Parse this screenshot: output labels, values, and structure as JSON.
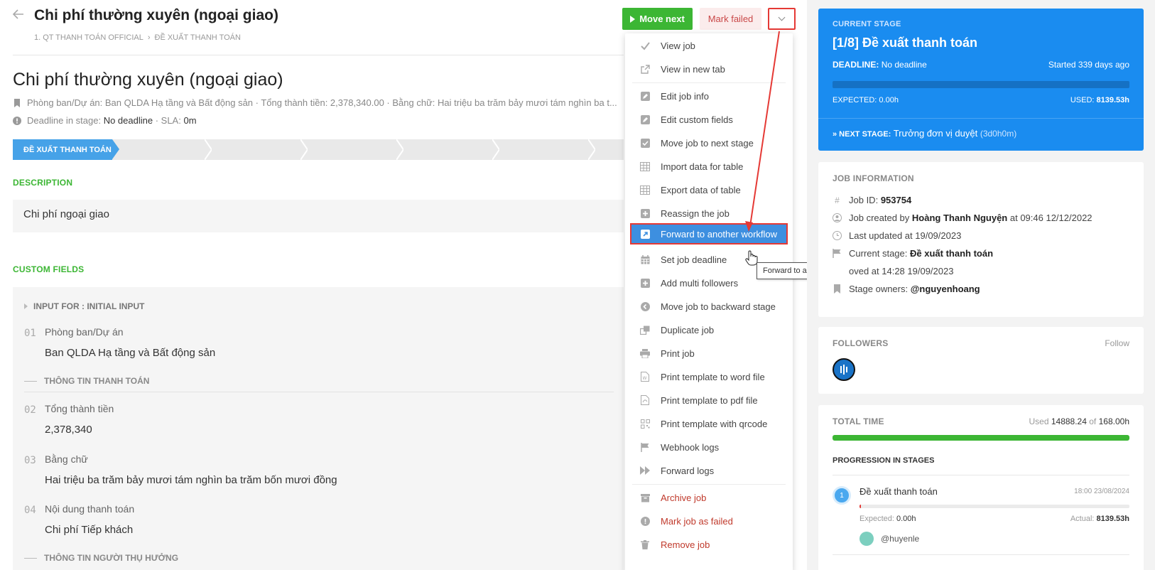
{
  "header": {
    "title": "Chi phí thường xuyên (ngoại giao)",
    "breadcrumb": [
      "1. QT THANH TOÁN OFFICIAL",
      "ĐỀ XUẤT THANH TOÁN"
    ],
    "buttons": {
      "move_next": "Move next",
      "mark_failed": "Mark failed"
    }
  },
  "job": {
    "title": "Chi phí thường xuyên (ngoại giao)",
    "summary": "Phòng ban/Dự án: Ban QLDA Hạ tầng và Bất động sản · Tổng thành tiền: 2,378,340.00 · Bằng chữ: Hai triệu ba trăm bảy mươi tám nghìn ba t...",
    "deadline_label": "Deadline in stage:",
    "deadline_value": "No deadline",
    "sla_label": "· SLA:",
    "sla_value": "0m",
    "active_stage": "ĐỀ XUẤT THANH TOÁN"
  },
  "description": {
    "label": "DESCRIPTION",
    "text": "Chi phí ngoại giao"
  },
  "custom_fields": {
    "label": "CUSTOM FIELDS",
    "group": "INPUT FOR : INITIAL INPUT",
    "fields": [
      {
        "num": "01",
        "label": "Phòng ban/Dự án",
        "value": "Ban QLDA Hạ tầng và Bất động sản"
      },
      {
        "num": "02",
        "label": "Tổng thành tiền",
        "value": "2,378,340"
      },
      {
        "num": "03",
        "label": "Bằng chữ",
        "value": "Hai triệu ba trăm bảy mươi tám nghìn ba trăm bốn mươi đồng"
      },
      {
        "num": "04",
        "label": "Nội dung thanh toán",
        "value": "Chi phí Tiếp khách"
      }
    ],
    "sections": [
      "THÔNG TIN THANH TOÁN",
      "THÔNG TIN NGƯỜI THỤ HƯỞNG"
    ]
  },
  "menu": {
    "items": [
      {
        "label": "View job",
        "icon": "check-icon"
      },
      {
        "label": "View in new tab",
        "icon": "external-link-icon"
      },
      {
        "label": "Edit job info",
        "icon": "edit-icon"
      },
      {
        "label": "Edit custom fields",
        "icon": "edit-icon"
      },
      {
        "label": "Move job to next stage",
        "icon": "check-square-icon"
      },
      {
        "label": "Import data for table",
        "icon": "table-icon"
      },
      {
        "label": "Export data of table",
        "icon": "table-icon"
      },
      {
        "label": "Reassign the job",
        "icon": "plus-square-icon"
      },
      {
        "label": "Forward to another workflow",
        "icon": "share-square-icon"
      },
      {
        "label": "Set job deadline",
        "icon": "calendar-icon"
      },
      {
        "label": "Add multi followers",
        "icon": "plus-square-icon"
      },
      {
        "label": "Move job to backward stage",
        "icon": "arrow-circle-left-icon"
      },
      {
        "label": "Duplicate job",
        "icon": "copy-icon"
      },
      {
        "label": "Print job",
        "icon": "printer-icon"
      },
      {
        "label": "Print template to word file",
        "icon": "word-file-icon"
      },
      {
        "label": "Print template to pdf file",
        "icon": "pdf-file-icon"
      },
      {
        "label": "Print template with qrcode",
        "icon": "qrcode-icon"
      },
      {
        "label": "Webhook logs",
        "icon": "flag-icon"
      },
      {
        "label": "Forward logs",
        "icon": "fast-forward-icon"
      },
      {
        "label": "Archive job",
        "icon": "archive-icon"
      },
      {
        "label": "Mark job as failed",
        "icon": "exclamation-circle-icon"
      },
      {
        "label": "Remove job",
        "icon": "trash-icon"
      }
    ],
    "tooltip": "Forward to another workflow"
  },
  "current_stage": {
    "label": "CURRENT STAGE",
    "title": "[1/8] Đề xuất thanh toán",
    "deadline_label": "DEADLINE:",
    "deadline_value": "No deadline",
    "started": "Started 339 days ago",
    "expected": "EXPECTED: 0.00h",
    "used_label": "USED:",
    "used_value": "8139.53h",
    "next_label": "» NEXT STAGE:",
    "next_value": "Trưởng đơn vị duyệt",
    "next_duration": "(3d0h0m)"
  },
  "job_info": {
    "label": "JOB INFORMATION",
    "job_id_label": "Job ID:",
    "job_id": "953754",
    "created_label": "Job created by",
    "created_by": "Hoàng Thanh Nguyện",
    "created_at": "at 09:46 12/12/2022",
    "last_updated": "Last updated at 19/09/2023",
    "current_stage_label": "Current stage:",
    "current_stage": "Đề xuất thanh toán",
    "moved": "oved at 14:28 19/09/2023",
    "owners_label": "Stage owners:",
    "owners": "@nguyenhoang"
  },
  "followers": {
    "label": "FOLLOWERS",
    "follow": "Follow"
  },
  "total_time": {
    "label": "TOTAL TIME",
    "used_prefix": "Used",
    "used": "14888.24",
    "of": "of",
    "total": "168.00h",
    "progress_label": "PROGRESSION IN STAGES",
    "stage": {
      "num": "1",
      "name": "Đề xuất thanh toán",
      "date": "18:00 23/08/2024",
      "expected_label": "Expected:",
      "expected": "0.00h",
      "actual_label": "Actual:",
      "actual": "8139.53h",
      "owner": "@huyenle"
    }
  },
  "colors": {
    "green": "#3cb634",
    "blue_stage": "#1a8cf0",
    "danger": "#c0392b",
    "annotation": "#e53935"
  }
}
